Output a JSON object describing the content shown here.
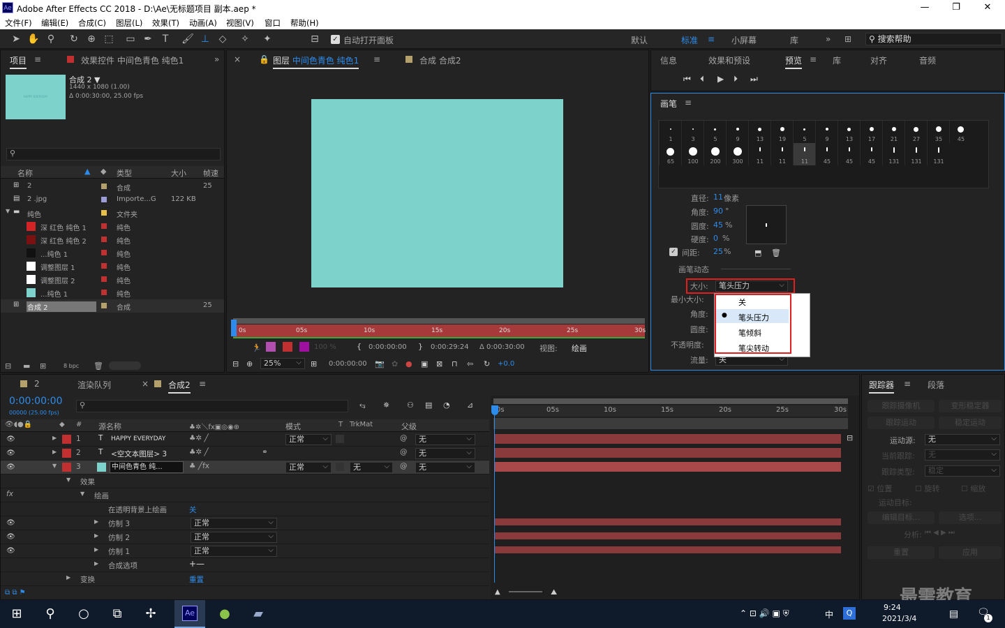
{
  "title": {
    "icon": "Ae",
    "text": "Adobe After Effects CC 2018 - D:\\Ae\\无标题项目 副本.aep *",
    "min": "—",
    "max": "❐",
    "close": "✕"
  },
  "menu": [
    "文件(F)",
    "编辑(E)",
    "合成(C)",
    "图层(L)",
    "效果(T)",
    "动画(A)",
    "视图(V)",
    "窗口",
    "帮助(H)"
  ],
  "toolbar": {
    "auto_open": "自动打开面板",
    "workspaces": [
      "默认",
      "标准",
      "小屏幕",
      "库"
    ],
    "active_ws": "标准",
    "more": "»",
    "search_placeholder": "搜索帮助"
  },
  "project": {
    "tab": "项目",
    "effects_tab": "效果控件 中间色青色 纯色1",
    "more": "»",
    "comp_name": "合成 2",
    "comp_size": "1440 x 1080 (1.00)",
    "comp_dur": "Δ 0:00:30:00, 25.00 fps",
    "thumb_text": "HAPPY EVERYDAY",
    "cols": [
      "名称",
      "类型",
      "大小",
      "帧速"
    ],
    "items": [
      {
        "name": "2",
        "type": "合成",
        "size": "",
        "fps": "25",
        "swatch": "#b3a06a",
        "icon": "comp",
        "indent": 0
      },
      {
        "name": "2 .jpg",
        "type": "Importe...G",
        "size": "122 KB",
        "fps": "",
        "swatch": "#9c9cd6",
        "icon": "file",
        "indent": 0
      },
      {
        "name": "纯色",
        "type": "文件夹",
        "size": "",
        "fps": "",
        "swatch": "#e7c244",
        "icon": "folder",
        "indent": 0
      },
      {
        "name": "深 红色 纯色 1",
        "type": "纯色",
        "size": "",
        "fps": "",
        "swatch": "#c03030",
        "color": "#d22424",
        "indent": 1
      },
      {
        "name": "深 红色 纯色 2",
        "type": "纯色",
        "size": "",
        "fps": "",
        "swatch": "#c03030",
        "color": "#7a1010",
        "indent": 1
      },
      {
        "name": "...纯色 1",
        "type": "纯色",
        "size": "",
        "fps": "",
        "swatch": "#c03030",
        "color": "#111111",
        "indent": 1
      },
      {
        "name": "调整图层 1",
        "type": "纯色",
        "size": "",
        "fps": "",
        "swatch": "#c03030",
        "color": "#ffffff",
        "indent": 1
      },
      {
        "name": "调整图层 2",
        "type": "纯色",
        "size": "",
        "fps": "",
        "swatch": "#c03030",
        "color": "#ffffff",
        "indent": 1
      },
      {
        "name": "...纯色 1",
        "type": "纯色",
        "size": "",
        "fps": "",
        "swatch": "#c03030",
        "color": "#7dd2cc",
        "indent": 1
      },
      {
        "name": "合成 2",
        "type": "合成",
        "size": "",
        "fps": "25",
        "swatch": "#b3a06a",
        "icon": "comp",
        "indent": 0,
        "selected": true
      }
    ],
    "bpc": "8 bpc"
  },
  "viewer": {
    "close": "×",
    "tab": "图层",
    "layer_name": "中间色青色 纯色1",
    "comp_tab": "合成 合成2",
    "ruler": [
      "0s",
      "05s",
      "10s",
      "15s",
      "20s",
      "25s",
      "30s"
    ],
    "opacity": "100 %",
    "t_in": "0:00:00:00",
    "t_out": "0:00:29:24",
    "t_dur": "Δ 0:00:30:00",
    "view_label": "视图:",
    "view_val": "绘画",
    "zoom": "25%",
    "time": "0:00:00:00",
    "exposure": "+0.0",
    "canvas_color": "#7dd2cc"
  },
  "right_tabs": [
    "信息",
    "效果和预设",
    "预览",
    "库",
    "对齐",
    "音频"
  ],
  "right_active": "预览",
  "brush": {
    "title": "画笔",
    "row1": [
      1,
      3,
      5,
      9,
      13,
      19,
      5,
      9,
      13,
      17,
      21,
      27,
      35,
      45
    ],
    "row2": [
      65,
      100,
      200,
      300,
      11,
      11,
      11,
      45,
      45,
      45,
      131,
      131,
      131
    ],
    "diameter_label": "直径:",
    "diameter": "11",
    "diameter_unit": "像素",
    "angle_label": "角度:",
    "angle": "90",
    "angle_unit": "°",
    "round_label": "圆度:",
    "round": "45",
    "round_unit": "%",
    "hard_label": "硬度:",
    "hard": "0",
    "hard_unit": "%",
    "spacing_label": "间距:",
    "spacing": "25",
    "spacing_unit": "%",
    "dynamics": "画笔动态",
    "size_label": "大小:",
    "size_val": "笔头压力",
    "minsize_label": "最小大小:",
    "angle2_label": "角度:",
    "round2_label": "圆度:",
    "opacity_label": "不透明度:",
    "flow_label": "流量:",
    "flow_val": "关",
    "menu": [
      "关",
      "笔头压力",
      "笔倾斜",
      "笔尖转动"
    ],
    "menu_selected": "笔头压力"
  },
  "timeline": {
    "tab_comp2": "2",
    "render": "渲染队列",
    "close": "×",
    "comp_tab": "合成2",
    "timecode": "0:00:00:00",
    "timecode_sub": "00000 (25.00 fps)",
    "cols": {
      "src": "源名称",
      "mode": "模式",
      "t": "T",
      "trk": "TrkMat",
      "parent": "父级"
    },
    "ruler": [
      "0s",
      "05s",
      "10s",
      "15s",
      "20s",
      "25s",
      "30s"
    ],
    "layers": [
      {
        "num": "1",
        "type": "T",
        "name": "HAPPY EVERYDAY",
        "mode": "正常",
        "trk": "",
        "parent": "无"
      },
      {
        "num": "2",
        "type": "T",
        "name": "<空文本图层> 3",
        "mode": "",
        "trk": "",
        "parent": "无"
      },
      {
        "num": "3",
        "type": "",
        "name": "中间色青色 纯...",
        "mode": "正常",
        "trk": "无",
        "parent": "无"
      }
    ],
    "effects": "效果",
    "paint": "绘画",
    "paint_on_trans": "在透明背景上绘画",
    "paint_on_val": "关",
    "clones": [
      {
        "name": "仿制 3",
        "mode": "正常"
      },
      {
        "name": "仿制 2",
        "mode": "正常"
      },
      {
        "name": "仿制 1",
        "mode": "正常"
      }
    ],
    "comp_opts": "合成选项",
    "comp_opts_val": "+—",
    "transform": "变换",
    "reset": "重置"
  },
  "tracker": {
    "tab": "跟踪器",
    "tab2": "段落",
    "track_cam": "跟踪摄像机",
    "warp": "变形稳定器",
    "track_motion": "跟踪运动",
    "stab": "稳定运动",
    "src_label": "运动源:",
    "src_val": "无",
    "cur_label": "当前跟踪:",
    "cur_val": "无",
    "type_label": "跟踪类型:",
    "type_val": "稳定",
    "pos": "位置",
    "rot": "旋转",
    "scale": "缩放",
    "target": "运动目标:",
    "edit_target": "编辑目标...",
    "options": "选项...",
    "analyze": "分析:",
    "reset": "重置",
    "apply": "应用"
  },
  "taskbar": {
    "time": "9:24",
    "date": "2021/3/4",
    "ime": "中",
    "watermark": "最需教育",
    "notif": "1"
  }
}
